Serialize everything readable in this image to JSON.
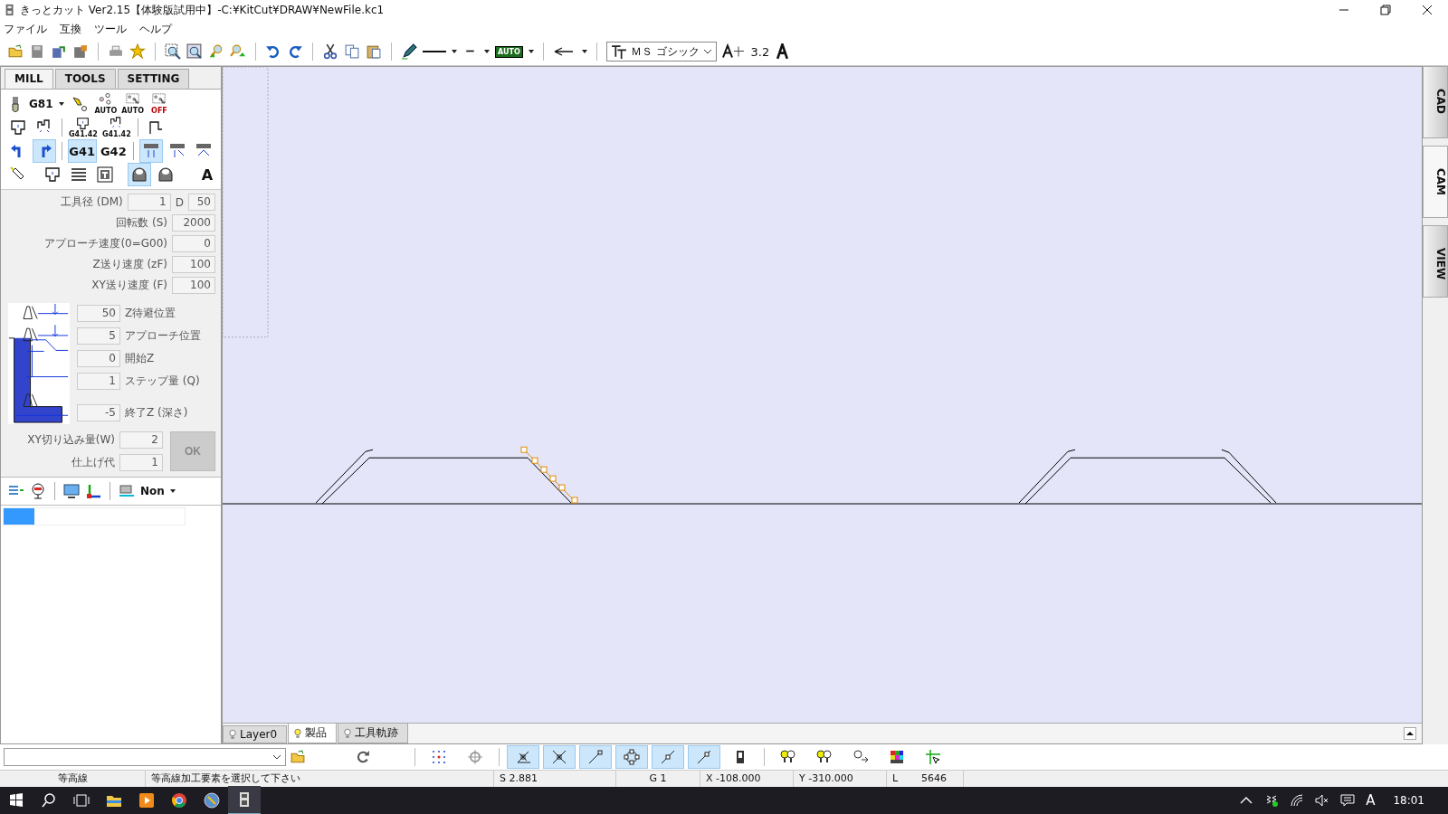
{
  "window": {
    "title": "きっとカット Ver2.15【体験版試用中】-C:¥KitCut¥DRAW¥NewFile.kc1"
  },
  "menu": [
    "ファイル",
    "互換",
    "ツール",
    "ヘルプ"
  ],
  "toolbar": {
    "groups": [
      [
        {
          "kind": "open"
        },
        {
          "kind": "save"
        },
        {
          "kind": "save-as"
        },
        {
          "kind": "export"
        }
      ],
      [
        {
          "kind": "print"
        },
        {
          "kind": "star"
        }
      ],
      [
        {
          "kind": "zoom-window"
        },
        {
          "kind": "zoom-fit"
        },
        {
          "kind": "zoom-in"
        },
        {
          "kind": "zoom-out"
        }
      ],
      [
        {
          "kind": "undo"
        },
        {
          "kind": "redo"
        }
      ],
      [
        {
          "kind": "cut"
        },
        {
          "kind": "copy"
        },
        {
          "kind": "paste"
        }
      ],
      [
        {
          "kind": "pen"
        },
        {
          "kind": "solid-line",
          "dropdown": true
        },
        {
          "kind": "dash",
          "dropdown": true
        },
        {
          "kind": "auto",
          "label": "AUTO",
          "dropdown": true
        }
      ],
      [
        {
          "kind": "arrow",
          "dropdown": true
        }
      ]
    ],
    "font": "ＭＳ ゴシック",
    "text_size": "3.2"
  },
  "left_panel": {
    "tabs": [
      {
        "label": "MILL",
        "selected": true
      },
      {
        "label": "TOOLS",
        "selected": false
      },
      {
        "label": "SETTING",
        "selected": false
      }
    ],
    "tool_rows": [
      [
        [
          {
            "kind": "endmill",
            "label": "G81",
            "dropdown": true,
            "selected": false
          },
          {
            "kind": "drill-point",
            "selected": false
          },
          {
            "kind": "points",
            "caption": "AUTO",
            "selected": false
          },
          {
            "kind": "grid-points",
            "caption": "AUTO",
            "selected": false
          },
          {
            "kind": "grid-points",
            "caption": "OFF",
            "selected": false
          }
        ]
      ],
      [
        [
          {
            "kind": "pocket",
            "selected": false
          },
          {
            "kind": "profile",
            "selected": false
          }
        ],
        [
          {
            "kind": "pocket",
            "caption": "G41.42",
            "selected": false
          },
          {
            "kind": "profile",
            "caption": "G41.42",
            "selected": false
          }
        ],
        [
          {
            "kind": "step",
            "selected": false
          }
        ]
      ],
      [
        [
          {
            "kind": "turn-left",
            "selected": false
          },
          {
            "kind": "turn-right",
            "selected": true
          }
        ],
        [
          {
            "kind": "text",
            "label": "G41",
            "selected": true
          },
          {
            "kind": "text",
            "label": "G42",
            "selected": false
          }
        ],
        [
          {
            "kind": "cut-down",
            "selected": true
          },
          {
            "kind": "cut-side",
            "selected": false
          },
          {
            "kind": "cut-arc",
            "selected": false
          }
        ]
      ],
      [
        [
          {
            "kind": "tool-holder",
            "selected": false
          }
        ],
        [
          {
            "kind": "pocket",
            "selected": false
          },
          {
            "kind": "lines",
            "selected": false
          },
          {
            "kind": "spiral",
            "selected": false
          }
        ],
        [
          {
            "kind": "dome",
            "selected": true
          },
          {
            "kind": "dome",
            "selected": false
          }
        ],
        [
          {
            "kind": "letter",
            "label": "A",
            "selected": false
          }
        ]
      ]
    ],
    "fields": [
      {
        "label": "工具径 (DM)",
        "value": "1",
        "extra_label": "D",
        "extra_value": "50"
      },
      {
        "label": "回転数 (S)",
        "value": "2000"
      },
      {
        "label": "アプローチ速度(0=G00)",
        "value": "0"
      },
      {
        "label": "Z送り速度 (zF)",
        "value": "100"
      },
      {
        "label": "XY送り速度 (F)",
        "value": "100"
      }
    ],
    "z_fields": [
      {
        "value": "50",
        "label": "Z待避位置"
      },
      {
        "value": "5",
        "label": "アプローチ位置"
      },
      {
        "value": "0",
        "label": "開始Z"
      },
      {
        "value": "1",
        "label": "ステップ量 (Q)"
      },
      {
        "value": "-5",
        "label": "終了Z (深さ)"
      }
    ],
    "xy_fields": [
      {
        "label": "XY切り込み量(W)",
        "value": "2"
      },
      {
        "label": "仕上げ代",
        "value": "1"
      }
    ],
    "ok_button": {
      "label": "OK",
      "disabled": true
    },
    "bottom_tools": [
      {
        "kind": "insert"
      },
      {
        "kind": "marker"
      },
      {
        "kind": "monitor"
      },
      {
        "kind": "axes"
      },
      {
        "kind": "machine",
        "label": "Non",
        "dropdown": true
      }
    ]
  },
  "right_tabs": [
    {
      "label": "CAD",
      "selected": false
    },
    {
      "label": "CAM",
      "selected": true
    },
    {
      "label": "VIEW",
      "selected": false
    }
  ],
  "layer_tabs": [
    {
      "label": "Layer0",
      "selected": false
    },
    {
      "label": "製品",
      "selected": true
    },
    {
      "label": "工具軌跡",
      "selected": false
    }
  ],
  "bottom_toolbar": {
    "groups": [
      [
        {
          "kind": "grid",
          "selected": false
        },
        {
          "kind": "crosshair",
          "selected": false
        }
      ],
      [
        {
          "kind": "snap-angle",
          "selected": true
        },
        {
          "kind": "snap-cross",
          "selected": true
        },
        {
          "kind": "snap-end",
          "selected": true
        },
        {
          "kind": "snap-circle",
          "selected": true
        },
        {
          "kind": "snap-mid",
          "selected": true
        },
        {
          "kind": "snap-line",
          "selected": true
        },
        {
          "kind": "phone",
          "selected": false
        }
      ],
      [
        {
          "kind": "bulbs",
          "selected": false
        },
        {
          "kind": "bulbs",
          "selected": false
        },
        {
          "kind": "bulb-arrow",
          "selected": false
        },
        {
          "kind": "palette",
          "selected": false
        },
        {
          "kind": "cursor",
          "selected": false
        }
      ]
    ]
  },
  "status_bar": [
    "等高線",
    "等高線加工要素を選択して下さい",
    "S 2.881",
    "G 1",
    "X -108.000",
    "Y -310.000",
    "L",
    "5646"
  ],
  "taskbar": {
    "ime": "A",
    "time": "18:01"
  }
}
